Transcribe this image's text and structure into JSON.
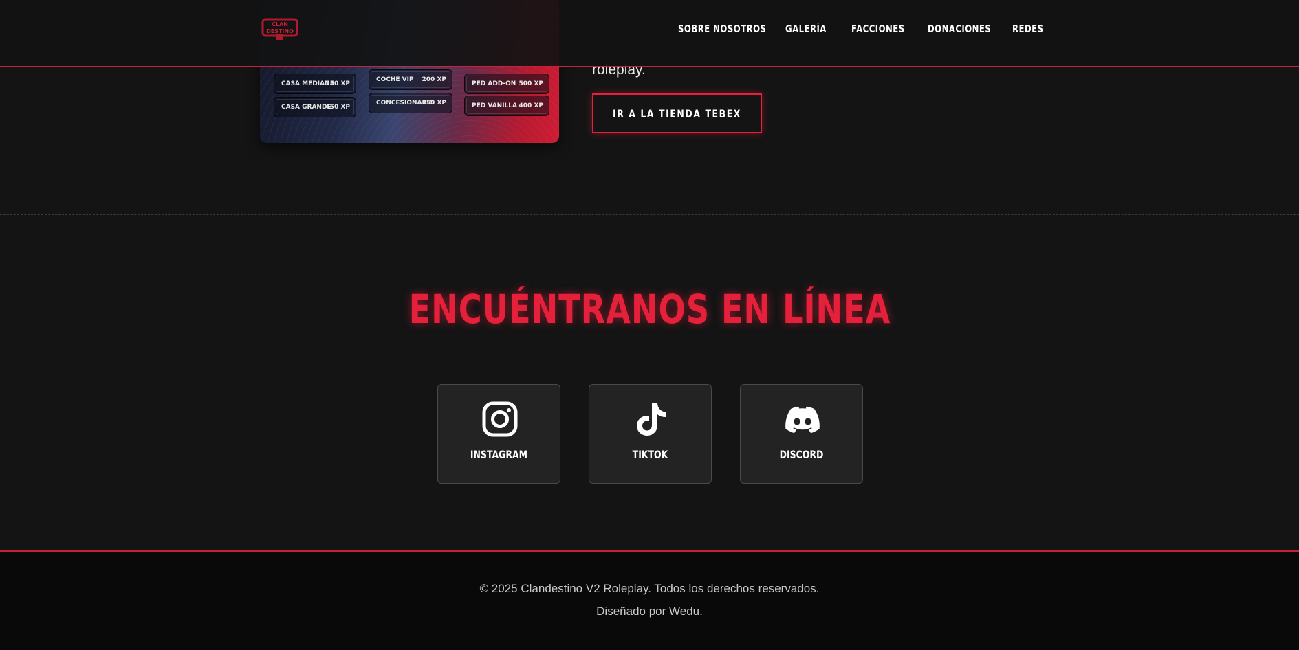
{
  "store_card": {
    "items": [
      {
        "name": "CASA MEDIANA",
        "price": "350 XP"
      },
      {
        "name": "CASA GRANDE",
        "price": "450 XP"
      },
      {
        "name": "COCHE VIP",
        "price": "200 XP"
      },
      {
        "name": "CONCESIONARIO",
        "price": "150 XP"
      },
      {
        "name": "PED ADD-ON",
        "price": "500 XP"
      },
      {
        "name": "PED VANILLA",
        "price": "400 XP"
      }
    ]
  },
  "nav": {
    "logo_text": "CLAN DESTINO",
    "links": [
      "SOBRE NOSOTROS",
      "GALERÍA",
      "FACCIONES",
      "DONACIONES",
      "REDES"
    ]
  },
  "donations": {
    "trailing_text": "roleplay.",
    "tebex_button": "IR A LA TIENDA TEBEX"
  },
  "socials": {
    "heading": "ENCUÉNTRANOS EN LÍNEA",
    "items": [
      {
        "label": "INSTAGRAM",
        "icon": "instagram-icon"
      },
      {
        "label": "TIKTOK",
        "icon": "tiktok-icon"
      },
      {
        "label": "DISCORD",
        "icon": "discord-icon"
      }
    ]
  },
  "footer": {
    "copyright": "© 2025 Clandestino V2 Roleplay. Todos los derechos reservados.",
    "credit": "Diseñado por Wedu."
  },
  "colors": {
    "accent": "#e4203b",
    "background": "#141414",
    "card": "#232323",
    "footer": "#090909"
  }
}
